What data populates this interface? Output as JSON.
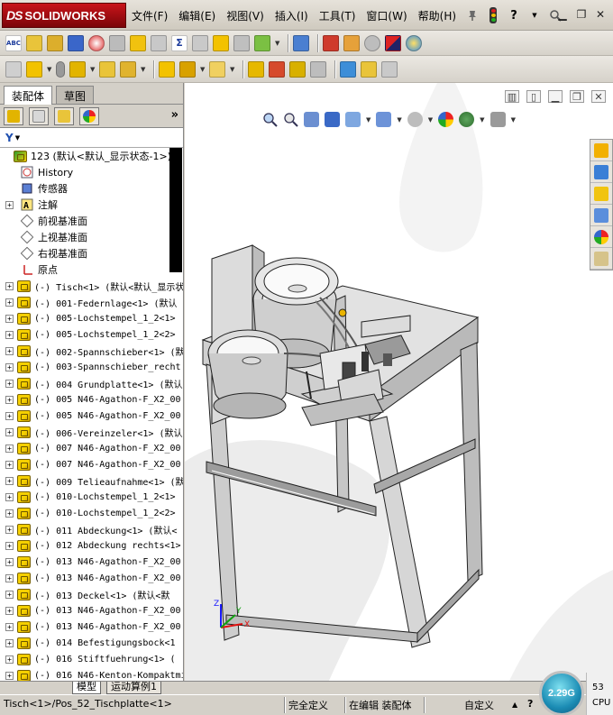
{
  "app": {
    "logo_prefix": "DS",
    "logo_text": "SOLIDWORKS"
  },
  "menu": [
    "文件(F)",
    "编辑(E)",
    "视图(V)",
    "插入(I)",
    "工具(T)",
    "窗口(W)",
    "帮助(H)"
  ],
  "title_icons": [
    "pin-icon",
    "traffic-light-icon",
    "help-icon",
    "help-dropdown-icon"
  ],
  "window_controls": [
    "minimize-icon",
    "restore-icon",
    "close-icon"
  ],
  "toolbar1": [
    "spell-check",
    "abc-icon",
    "balance-icon",
    "save-icon",
    "gauge-icon",
    "lock-icon",
    "check-icon",
    "check-gray-icon",
    "sigma-icon",
    "measure-icon",
    "warning-icon",
    "align-icon",
    "settings-check-icon",
    "table-icon",
    "mates-icon",
    "motor-icon",
    "gray-circle-icon",
    "red-blue-icon",
    "render-icon"
  ],
  "toolbar2": [
    "part-icon",
    "insert-component-icon",
    "paperclip-icon",
    "pattern-icon",
    "move-icon",
    "rotate-icon",
    "explode-icon",
    "smart-fastener-icon",
    "sketch-icon",
    "hide-show-icon",
    "instant3d-icon",
    "assembly-features-icon",
    "reference-geometry-icon",
    "new-motion-icon",
    "bill-icon",
    "large-design-icon"
  ],
  "left_panel": {
    "tabs": [
      "装配体",
      "草图"
    ],
    "active_tab": "装配体",
    "fm_tabs": [
      "feature-manager-icon",
      "property-manager-icon",
      "configuration-manager-icon",
      "display-manager-icon"
    ],
    "more": "»",
    "filter_icon": "filter-icon",
    "tree": [
      {
        "label": "123  (默认<默认_显示状态-1>)",
        "type": "assembly",
        "indent": 0,
        "exp": ""
      },
      {
        "label": "History",
        "type": "history",
        "indent": 1,
        "exp": ""
      },
      {
        "label": "传感器",
        "type": "sensor",
        "indent": 1,
        "exp": ""
      },
      {
        "label": "注解",
        "type": "annotation",
        "indent": 1,
        "exp": "+"
      },
      {
        "label": "前视基准面",
        "type": "plane",
        "indent": 1,
        "exp": ""
      },
      {
        "label": "上视基准面",
        "type": "plane",
        "indent": 1,
        "exp": ""
      },
      {
        "label": "右视基准面",
        "type": "plane",
        "indent": 1,
        "exp": ""
      },
      {
        "label": "原点",
        "type": "origin",
        "indent": 1,
        "exp": ""
      },
      {
        "label": "(-) Tisch<1> (默认<默认_显示状态",
        "type": "part",
        "indent": 1,
        "exp": "+"
      },
      {
        "label": "(-) 001-Federnlage<1> (默认",
        "type": "part",
        "indent": 1,
        "exp": "+"
      },
      {
        "label": "(-) 005-Lochstempel_1_2<1>",
        "type": "part",
        "indent": 1,
        "exp": "+"
      },
      {
        "label": "(-) 005-Lochstempel_1_2<2>",
        "type": "part",
        "indent": 1,
        "exp": "+"
      },
      {
        "label": "(-) 002-Spannschieber<1> (默",
        "type": "part",
        "indent": 1,
        "exp": "+"
      },
      {
        "label": "(-) 003-Spannschieber_recht",
        "type": "part",
        "indent": 1,
        "exp": "+"
      },
      {
        "label": "(-) 004 Grundplatte<1> (默认",
        "type": "part",
        "indent": 1,
        "exp": "+"
      },
      {
        "label": "(-) 005 N46-Agathon-F_X2_00",
        "type": "part",
        "indent": 1,
        "exp": "+"
      },
      {
        "label": "(-) 005 N46-Agathon-F_X2_00",
        "type": "part",
        "indent": 1,
        "exp": "+"
      },
      {
        "label": "(-) 006-Vereinzeler<1> (默认",
        "type": "part",
        "indent": 1,
        "exp": "+"
      },
      {
        "label": "(-) 007 N46-Agathon-F_X2_00",
        "type": "part",
        "indent": 1,
        "exp": "+"
      },
      {
        "label": "(-) 007 N46-Agathon-F_X2_00",
        "type": "part",
        "indent": 1,
        "exp": "+"
      },
      {
        "label": "(-) 009 Telieaufnahme<1> (默",
        "type": "part",
        "indent": 1,
        "exp": "+"
      },
      {
        "label": "(-) 010-Lochstempel_1_2<1>",
        "type": "part",
        "indent": 1,
        "exp": "+"
      },
      {
        "label": "(-) 010-Lochstempel_1_2<2>",
        "type": "part",
        "indent": 1,
        "exp": "+"
      },
      {
        "label": "(-) 011 Abdeckung<1> (默认<",
        "type": "part",
        "indent": 1,
        "exp": "+"
      },
      {
        "label": "(-) 012 Abdeckung rechts<1>",
        "type": "part",
        "indent": 1,
        "exp": "+"
      },
      {
        "label": "(-) 013 N46-Agathon-F_X2_00",
        "type": "part",
        "indent": 1,
        "exp": "+"
      },
      {
        "label": "(-) 013 N46-Agathon-F_X2_00",
        "type": "part",
        "indent": 1,
        "exp": "+"
      },
      {
        "label": "(-) 013 Deckel<1> (默认<默",
        "type": "part",
        "indent": 1,
        "exp": "+"
      },
      {
        "label": "(-) 013 N46-Agathon-F_X2_00",
        "type": "part",
        "indent": 1,
        "exp": "+"
      },
      {
        "label": "(-) 013 N46-Agathon-F_X2_00",
        "type": "part",
        "indent": 1,
        "exp": "+"
      },
      {
        "label": "(-) 014 Befestigungsbock<1",
        "type": "part",
        "indent": 1,
        "exp": "+"
      },
      {
        "label": "(-) 016 Stiftfuehrung<1> (",
        "type": "part",
        "indent": 1,
        "exp": "+"
      },
      {
        "label": "(-) 016 N46-Kenton-Kompaktmi",
        "type": "part",
        "indent": 1,
        "exp": "+"
      }
    ]
  },
  "viewport": {
    "controls": [
      "split-view-icon",
      "tile-icon",
      "minimize-icon",
      "restore-icon",
      "close-icon"
    ],
    "headsup": [
      "zoom-to-fit-icon",
      "zoom-area-icon",
      "previous-view-icon",
      "section-view-icon",
      "view-orientation-icon",
      "display-style-icon",
      "hide-show-items-icon",
      "edit-appearance-icon",
      "apply-scene-icon",
      "view-settings-icon"
    ],
    "taskpane": [
      "home-icon",
      "design-library-icon",
      "file-explorer-icon",
      "view-palette-icon",
      "appearances-icon",
      "custom-properties-icon"
    ],
    "triad_labels": [
      "Z",
      "X",
      "Y"
    ]
  },
  "bottom_tabs": [
    "模型",
    "运动算例1"
  ],
  "status": {
    "path": "Tisch<1>/Pos_52_Tischplatte<1>",
    "state": "完全定义",
    "editing": "在编辑 装配体",
    "custom": "自定义",
    "help_icon": "?",
    "memory": "2.29G",
    "cpu_value": "53",
    "cpu_label": "CPU"
  },
  "colors": {
    "logo_red": "#b5121b",
    "part_yellow": "#f5d000",
    "status_blue": "#1b8cb4"
  }
}
